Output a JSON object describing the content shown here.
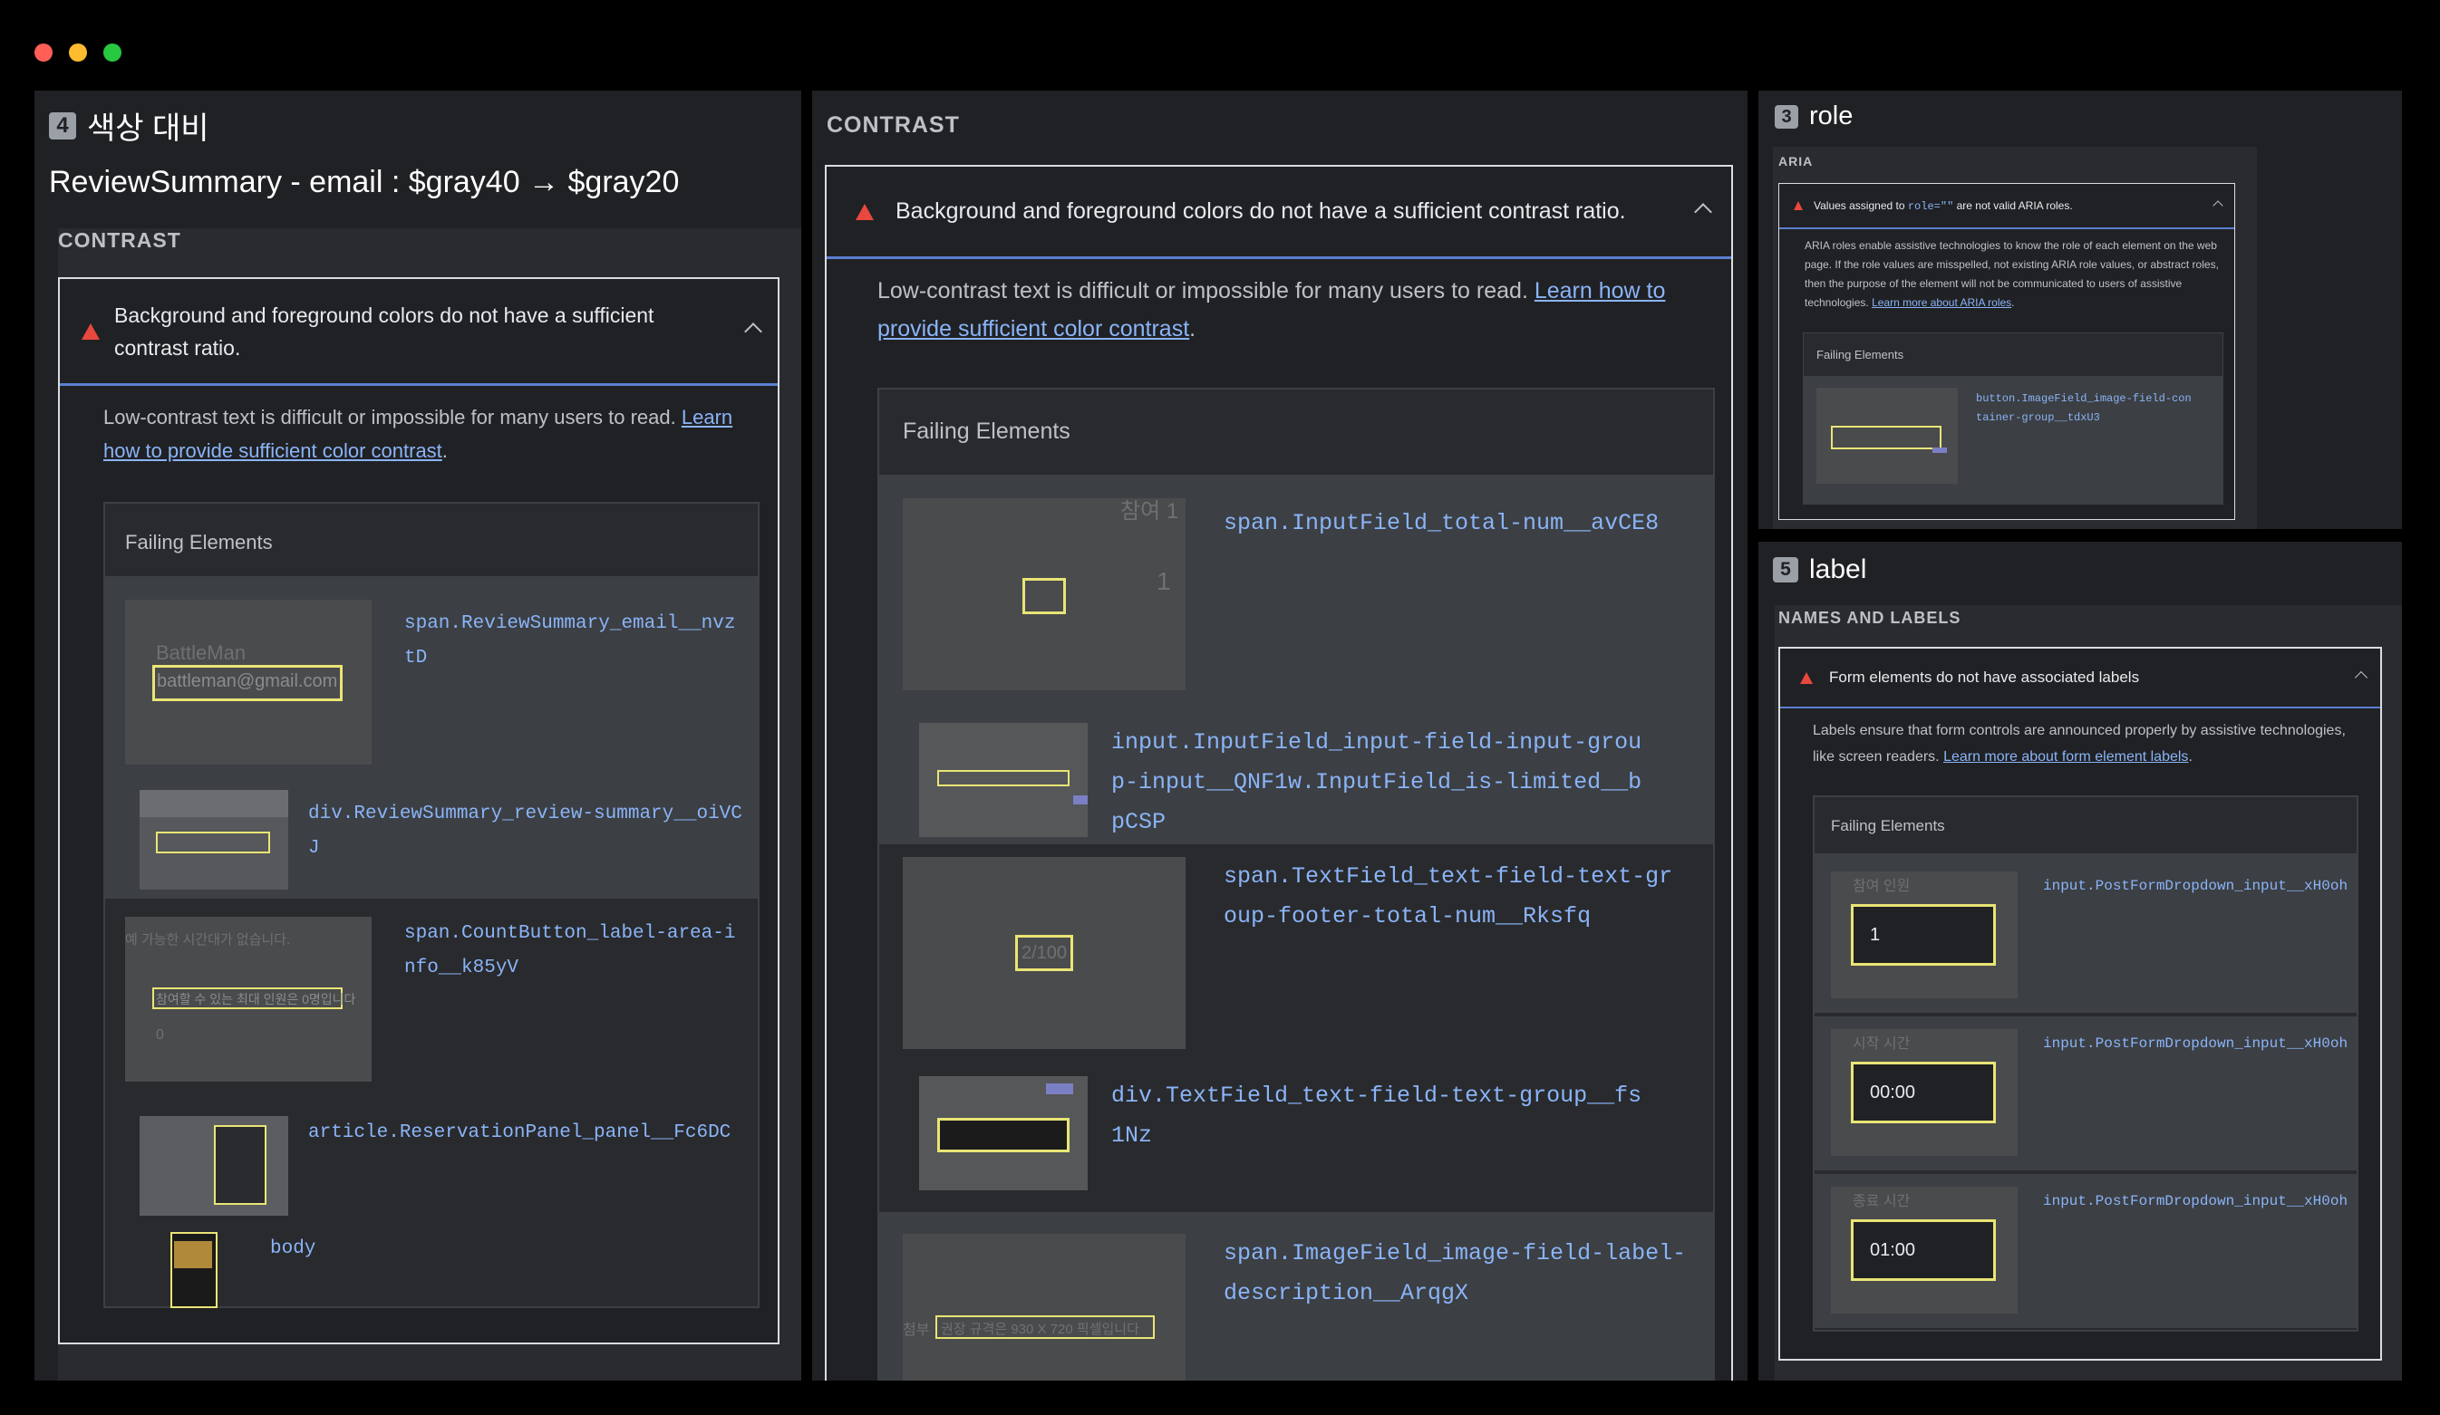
{
  "left": {
    "badge": "4",
    "heading": "색상 대비",
    "subheading": "ReviewSummary - email : $gray40 → $gray20",
    "category": "CONTRAST",
    "audit_title": "Background and foreground colors do not have a sufficient contrast ratio.",
    "desc_text": "Low-contrast text is difficult or impossible for many users to read. ",
    "desc_link": "Learn how to provide sufficient color contrast",
    "desc_end": ".",
    "failing_title": "Failing Elements",
    "items": [
      {
        "selector": "span.ReviewSummary_email__nvztD",
        "thumb_text1": "BattleMan",
        "thumb_text2": "battleman@gmail.com"
      },
      {
        "selector": "div.ReviewSummary_review-summary__oiVCJ"
      },
      {
        "selector": "span.CountButton_label-area-info__k85yV",
        "thumb_text1": "예 가능한 시간대가 없습니다.",
        "thumb_text2": "참여할 수 있는 최대 인원은 0명입니다",
        "thumb_text3": "0"
      },
      {
        "selector": "article.ReservationPanel_panel__Fc6DC"
      },
      {
        "selector": "body"
      }
    ]
  },
  "middle": {
    "category": "CONTRAST",
    "audit_title": "Background and foreground colors do not have a sufficient contrast ratio.",
    "desc_text": "Low-contrast text is difficult or impossible for many users to read. ",
    "desc_link": "Learn how to provide sufficient color contrast",
    "desc_end": ".",
    "failing_title": "Failing Elements",
    "items": [
      {
        "selector": "span.InputField_total-num__avCE8",
        "thumb_text1": "참여 1",
        "thumb_text2": "1"
      },
      {
        "selector": "input.InputField_input-field-input-group-input__QNF1w.InputField_is-limited__bpCSP"
      },
      {
        "selector": "span.TextField_text-field-text-group-footer-total-num__Rksfq",
        "thumb_text1": "2/100"
      },
      {
        "selector": "div.TextField_text-field-text-group__fs1Nz"
      },
      {
        "selector": "span.ImageField_image-field-label-description__ArqgX",
        "thumb_text1": "첨부",
        "thumb_text2": "권장 규격은 930 X 720 픽셀입니다"
      }
    ]
  },
  "top_right": {
    "badge": "3",
    "heading": "role",
    "category": "ARIA",
    "audit_title_pre": "Values assigned to ",
    "audit_title_code": "role=\"\"",
    "audit_title_post": " are not valid ARIA roles.",
    "desc": "ARIA roles enable assistive technologies to know the role of each element on the web page. If the role values are misspelled, not existing ARIA role values, or abstract roles, then the purpose of the element will not be communicated to users of assistive technologies. ",
    "desc_link": "Learn more about ARIA roles",
    "desc_end": ".",
    "failing_title": "Failing Elements",
    "items": [
      {
        "selector": "button.ImageField_image-field-container-group__tdxU3"
      }
    ]
  },
  "bottom_right": {
    "badge": "5",
    "heading": "label",
    "category": "NAMES AND LABELS",
    "audit_title": "Form elements do not have associated labels",
    "desc": "Labels ensure that form controls are announced properly by assistive technologies, like screen readers. ",
    "desc_link": "Learn more about form element labels",
    "desc_end": ".",
    "failing_title": "Failing Elements",
    "items": [
      {
        "selector": "input.PostFormDropdown_input__xH0oh",
        "thumb_label": "참여 인원",
        "thumb_value": "1"
      },
      {
        "selector": "input.PostFormDropdown_input__xH0oh",
        "thumb_label": "시작 시간",
        "thumb_value": "00:00"
      },
      {
        "selector": "input.PostFormDropdown_input__xH0oh",
        "thumb_label": "종료 시간",
        "thumb_value": "01:00"
      }
    ]
  },
  "colors": {
    "close": "#ff5f57",
    "minimize": "#febc2e",
    "zoom": "#28c840",
    "warning": "#e9483e",
    "highlight": "#e9e575",
    "link": "#8ab4f8"
  }
}
